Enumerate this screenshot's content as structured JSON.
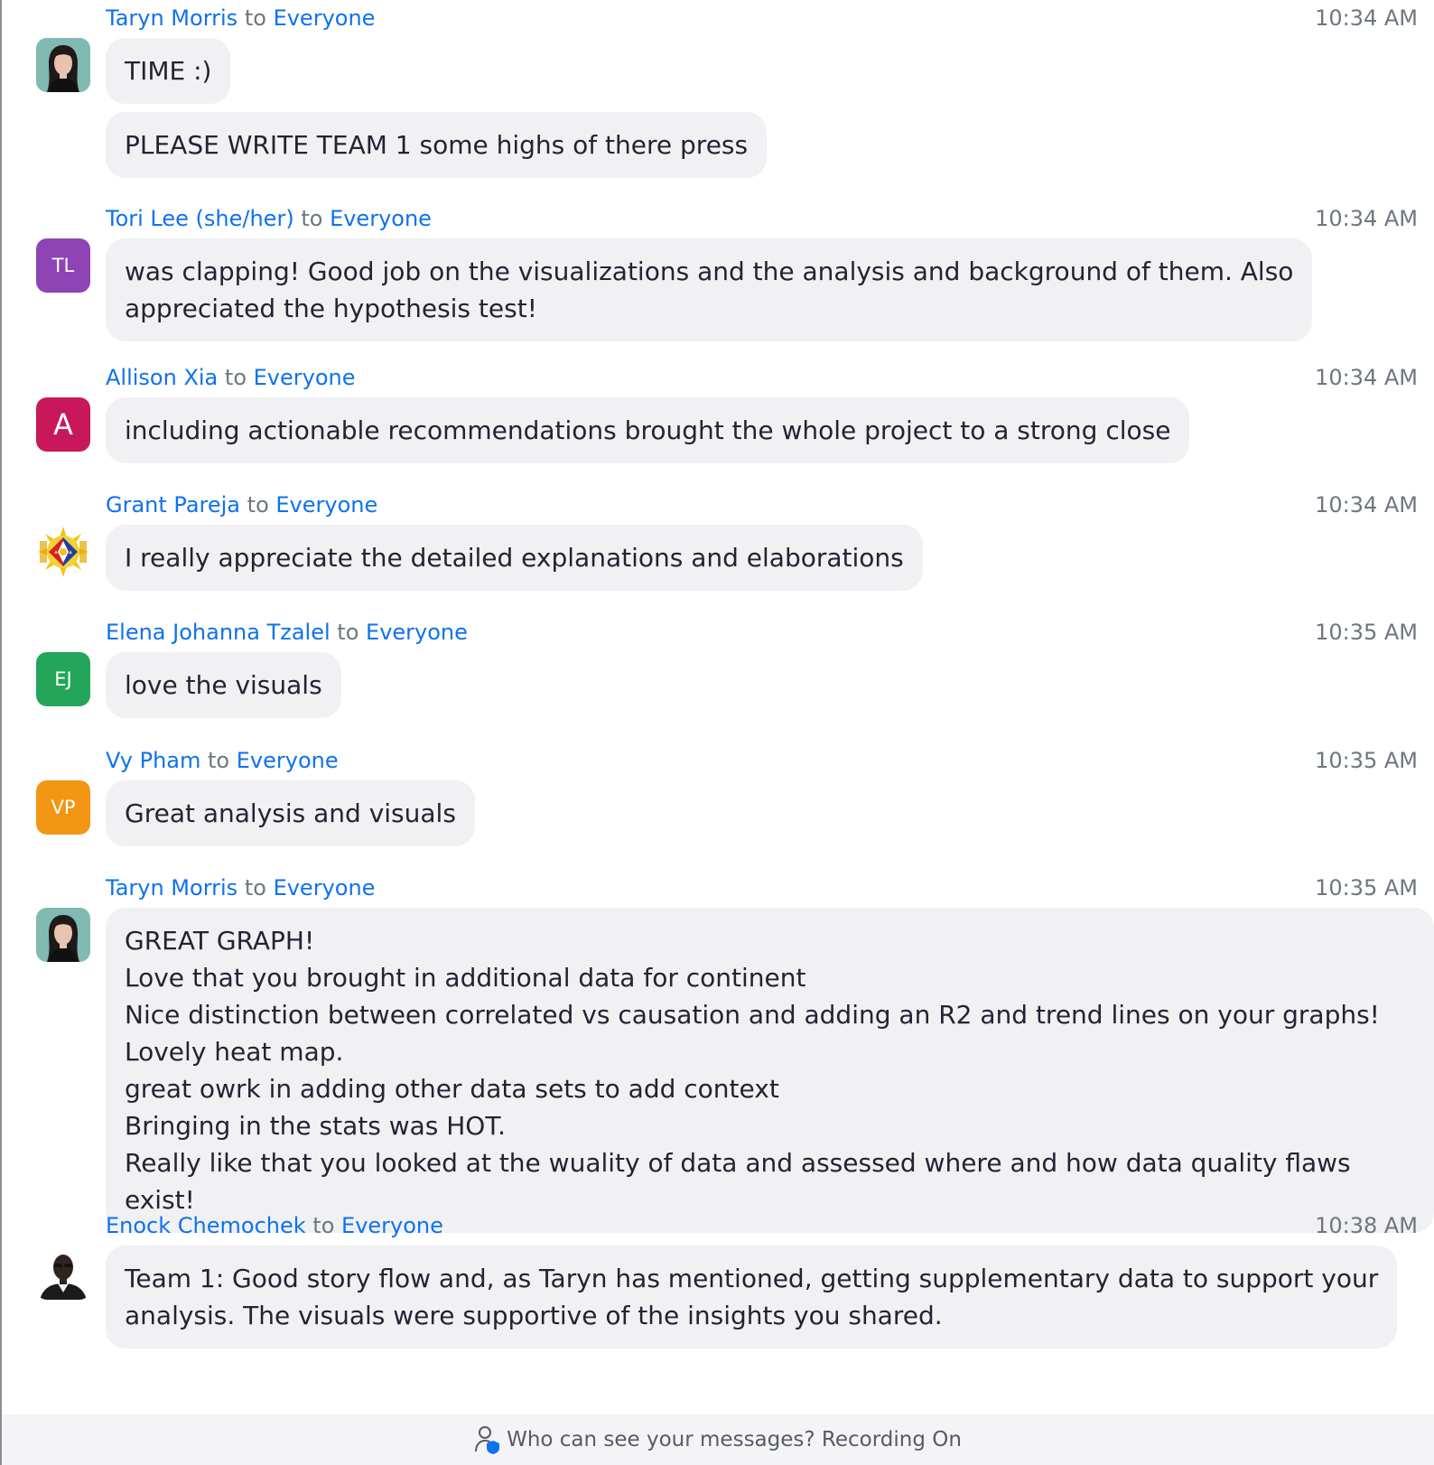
{
  "messages": [
    {
      "sender": "Taryn Morris",
      "to_word": "to",
      "recipient": "Everyone",
      "time": "10:34 AM",
      "avatar": {
        "kind": "photo",
        "icon": "woman-portrait-photo"
      },
      "bubbles": [
        "TIME :)",
        "PLEASE WRITE TEAM 1 some highs of there press"
      ]
    },
    {
      "sender": "Tori Lee (she/her)",
      "to_word": "to",
      "recipient": "Everyone",
      "time": "10:34 AM",
      "avatar": {
        "kind": "initials",
        "initials": "TL",
        "color": "#8e44b5"
      },
      "bubbles": [
        "was clapping! Good job on the visualizations and the analysis and background of them. Also\nappreciated the hypothesis test!"
      ]
    },
    {
      "sender": "Allison Xia",
      "to_word": "to",
      "recipient": "Everyone",
      "time": "10:34 AM",
      "avatar": {
        "kind": "initials",
        "initials": "A",
        "color": "#c8185a"
      },
      "bubbles": [
        "including actionable recommendations brought the whole project to a strong close"
      ]
    },
    {
      "sender": "Grant Pareja",
      "to_word": "to",
      "recipient": "Everyone",
      "time": "10:34 AM",
      "avatar": {
        "kind": "emblem",
        "icon": "philippine-emblem-icon"
      },
      "bubbles": [
        "I really appreciate the detailed explanations and elaborations"
      ]
    },
    {
      "sender": "Elena Johanna Tzalel",
      "to_word": "to",
      "recipient": "Everyone",
      "time": "10:35 AM",
      "avatar": {
        "kind": "initials",
        "initials": "EJ",
        "color": "#23a55a"
      },
      "bubbles": [
        "love the visuals"
      ]
    },
    {
      "sender": "Vy Pham",
      "to_word": "to",
      "recipient": "Everyone",
      "time": "10:35 AM",
      "avatar": {
        "kind": "initials",
        "initials": "VP",
        "color": "#f29613"
      },
      "bubbles": [
        "Great analysis and visuals"
      ]
    },
    {
      "sender": "Taryn Morris",
      "to_word": "to",
      "recipient": "Everyone",
      "time": "10:35 AM",
      "avatar": {
        "kind": "photo",
        "icon": "woman-portrait-photo"
      },
      "bubbles": [
        "GREAT GRAPH!\nLove that you brought in additional data for continent\nNice distinction between correlated vs causation and adding an R2 and trend lines on your graphs!\nLovely heat map.\ngreat owrk in adding other data sets to add context\nBringing in the stats was HOT.\nReally like that you looked at the wuality of data and assessed where and how data quality flaws exist!"
      ]
    },
    {
      "sender": "Enock Chemochek",
      "to_word": "to",
      "recipient": "Everyone",
      "time": "10:38 AM",
      "avatar": {
        "kind": "photo",
        "icon": "man-portrait-photo"
      },
      "bubbles": [
        "Team 1: Good story flow and, as Taryn has mentioned, getting supplementary data to support your\nanalysis. The visuals were supportive of the insights you shared."
      ]
    }
  ],
  "footer": {
    "icon": "person-shield-icon",
    "text": "Who can see your messages? Recording On"
  }
}
